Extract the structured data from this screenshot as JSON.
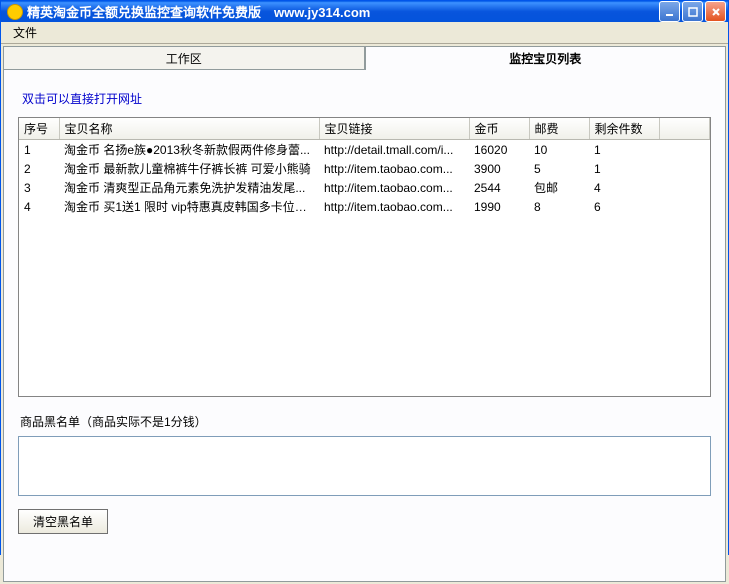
{
  "window": {
    "title": "精英淘金币全额兑换监控查询软件免费版　www.jy314.com"
  },
  "menu": {
    "file": "文件"
  },
  "tabs": {
    "workarea": "工作区",
    "monitor": "监控宝贝列表"
  },
  "hint": "双击可以直接打开网址",
  "columns": {
    "no": "序号",
    "name": "宝贝名称",
    "link": "宝贝链接",
    "gold": "金币",
    "ship": "邮费",
    "remain": "剩余件数"
  },
  "rows": [
    {
      "no": "1",
      "name": "淘金币 名扬e族●2013秋冬新款假两件修身蕾...",
      "link": "http://detail.tmall.com/i...",
      "gold": "16020",
      "ship": "10",
      "remain": "1"
    },
    {
      "no": "2",
      "name": "淘金币 最新款儿童棉裤牛仔裤长裤 可爱小熊骑",
      "link": "http://item.taobao.com...",
      "gold": "3900",
      "ship": "5",
      "remain": "1"
    },
    {
      "no": "3",
      "name": "淘金币 清爽型正品角元素免洗护发精油发尾...",
      "link": "http://item.taobao.com...",
      "gold": "2544",
      "ship": "包邮",
      "remain": "4"
    },
    {
      "no": "4",
      "name": "淘金币 买1送1 限时 vip特惠真皮韩国多卡位卡...",
      "link": "http://item.taobao.com...",
      "gold": "1990",
      "ship": "8",
      "remain": "6"
    }
  ],
  "blacklist": {
    "label": "商品黑名单（商品实际不是1分钱）",
    "clear": "清空黑名单"
  }
}
